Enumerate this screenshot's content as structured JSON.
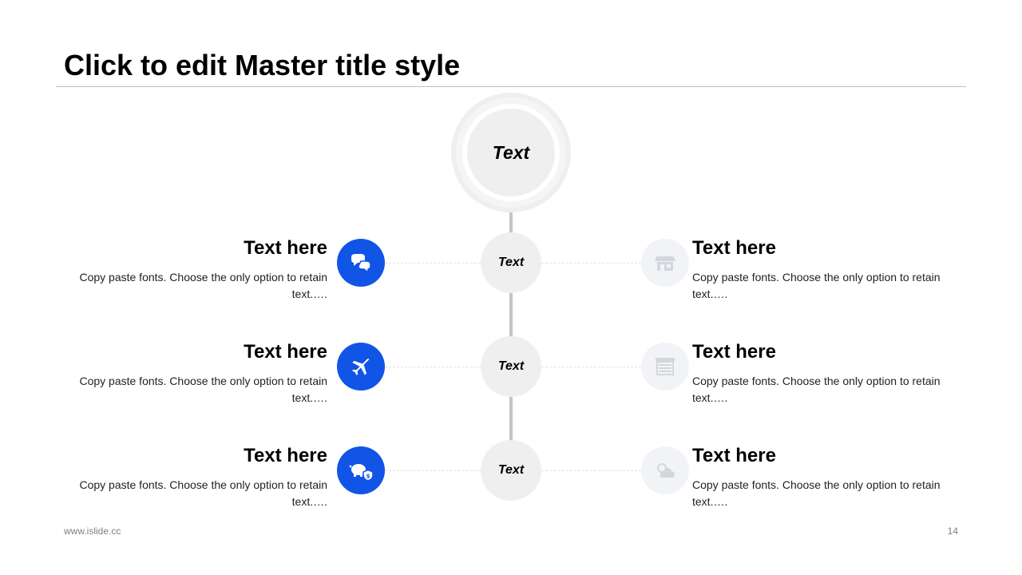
{
  "slide": {
    "title": "Click to edit Master title style",
    "center_label": "Text",
    "footer_url": "www.islide.cc",
    "page_number": "14"
  },
  "nodes": [
    {
      "label": "Text"
    },
    {
      "label": "Text"
    },
    {
      "label": "Text"
    }
  ],
  "left_items": [
    {
      "title": "Text here",
      "desc": "Copy paste fonts. Choose the only option to retain text.….",
      "icon": "chat-bubbles-icon"
    },
    {
      "title": "Text here",
      "desc": "Copy paste fonts. Choose the only option to retain text.….",
      "icon": "airplane-icon"
    },
    {
      "title": "Text here",
      "desc": "Copy paste fonts. Choose the only option to retain text.….",
      "icon": "piggy-bank-icon"
    }
  ],
  "right_items": [
    {
      "title": "Text here",
      "desc": "Copy paste fonts. Choose the only option to retain text.….",
      "icon": "storefront-icon"
    },
    {
      "title": "Text here",
      "desc": "Copy paste fonts. Choose the only option to retain text.….",
      "icon": "shutter-door-icon"
    },
    {
      "title": "Text here",
      "desc": "Copy paste fonts. Choose the only option to retain text.….",
      "icon": "cloud-icon"
    }
  ],
  "colors": {
    "accent": "#1155e6",
    "node_fill": "#efefef",
    "muted_icon_fill": "#f2f3f6",
    "muted_icon_glyph": "#d4d6dc"
  }
}
